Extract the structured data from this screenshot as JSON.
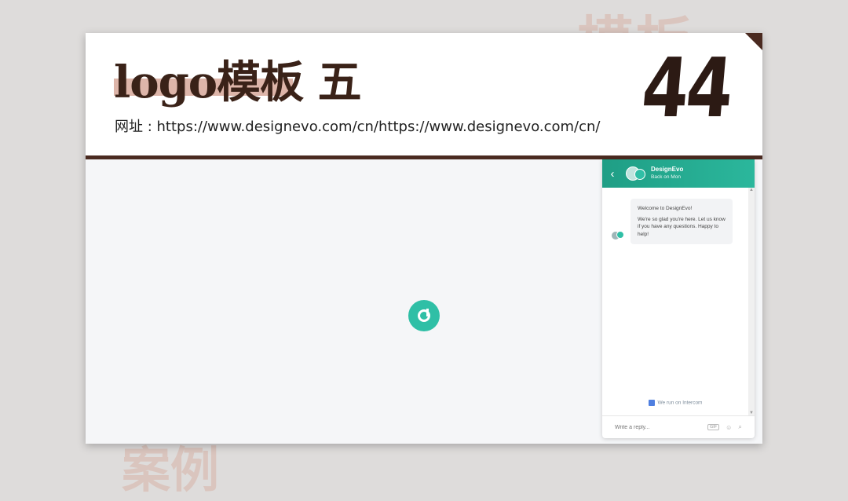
{
  "background": {
    "top_chars": "模板",
    "bottom_chars": "案例"
  },
  "slide": {
    "title": "logo模板 五",
    "subtitle": "网址 : https://www.designevo.com/cn/https://www.designevo.com/cn/",
    "page_number": "44"
  },
  "chat": {
    "name": "DesignEvo",
    "status": "Back on Mon",
    "message": {
      "line1": "Welcome to DesignEvo!",
      "line2": "We're so glad you're here. Let us know if you have any questions. Happy to help!"
    },
    "powered_by": "We run on Intercom",
    "reply_placeholder": "Write a reply..."
  },
  "colors": {
    "accent": "#2fbfa6",
    "brand_dark": "#4a2a20",
    "highlight": "#d7a89a"
  },
  "icons": [
    "back-icon",
    "designevo-logo-icon",
    "gif-icon",
    "emoji-icon",
    "attachment-icon"
  ]
}
